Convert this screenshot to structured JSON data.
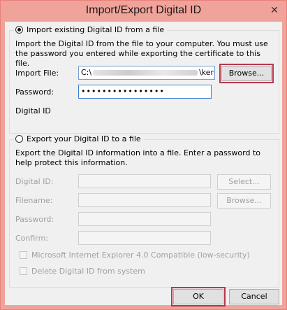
{
  "window": {
    "title": "Import/Export Digital ID",
    "close_glyph": "✕"
  },
  "import_group": {
    "legend": "Import existing Digital ID from a file",
    "description": "Import the Digital ID from the file to your computer. You must use the password you entered while exporting the certificate to this file.",
    "import_file_label": "Import File:",
    "import_file_value_start": "C:\\",
    "import_file_value_end": "\\kerne",
    "browse_label": "Browse...",
    "password_label": "Password:",
    "password_value": "••••••••••••••••",
    "digital_id_label": "Digital ID"
  },
  "export_group": {
    "legend": "Export your Digital ID to a file",
    "description": "Export the Digital ID information into a file. Enter a password to help protect this information.",
    "digital_id_label": "Digital ID:",
    "select_label": "Select...",
    "filename_label": "Filename:",
    "browse_label": "Browse...",
    "password_label": "Password:",
    "confirm_label": "Confirm:",
    "ie_compat_label": "Microsoft Internet Explorer 4.0 Compatible (low-security)",
    "delete_label": "Delete Digital ID from system"
  },
  "buttons": {
    "ok": "OK",
    "cancel": "Cancel"
  },
  "colors": {
    "titlebar": "#f0a39a",
    "highlight": "#b8364b"
  }
}
